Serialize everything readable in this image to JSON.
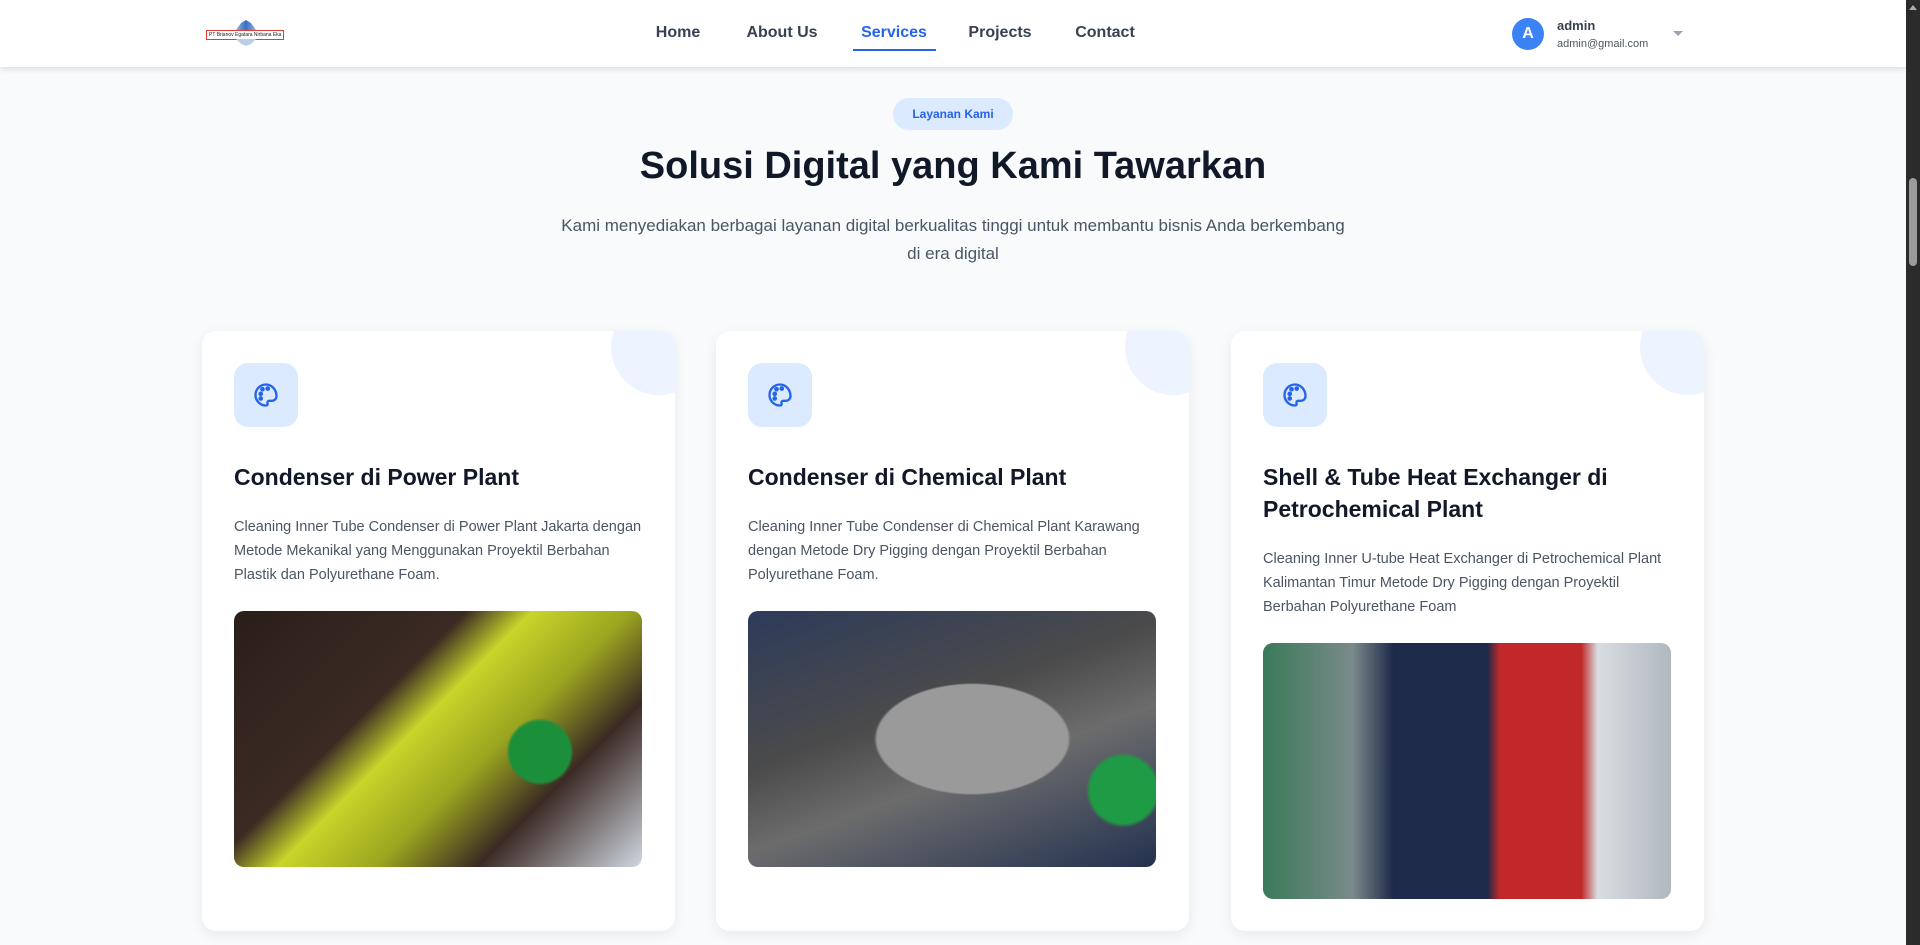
{
  "brand": {
    "logo_text": "PT Brianov Egatara Nirbana Eka"
  },
  "nav": {
    "items": [
      "Home",
      "About Us",
      "Services",
      "Projects",
      "Contact"
    ],
    "active": "Services"
  },
  "user": {
    "initial": "A",
    "name": "admin",
    "email": "admin@gmail.com"
  },
  "hero": {
    "badge": "Layanan Kami",
    "title": "Solusi Digital yang Kami Tawarkan",
    "subtitle": "Kami menyediakan berbagai layanan digital berkualitas tinggi untuk membantu bisnis Anda berkembang di era digital"
  },
  "services": [
    {
      "icon": "palette-icon",
      "title": "Condenser di Power Plant",
      "description": "Cleaning Inner Tube Condenser di Power Plant Jakarta dengan Metode Mekanikal yang Menggunakan Proyektil Berbahan Plastik dan Polyurethane Foam."
    },
    {
      "icon": "palette-icon",
      "title": "Condenser di Chemical Plant",
      "description": "Cleaning Inner Tube Condenser di Chemical Plant Karawang dengan Metode Dry Pigging dengan Proyektil Berbahan Polyurethane Foam."
    },
    {
      "icon": "palette-icon",
      "title": "Shell & Tube Heat Exchanger di Petrochemical Plant",
      "description": "Cleaning Inner U-tube Heat Exchanger di Petrochemical Plant Kalimantan Timur Metode Dry Pigging dengan Proyektil Berbahan Polyurethane Foam"
    }
  ],
  "colors": {
    "accent": "#2563eb",
    "icon_bg": "#dbeafe"
  }
}
